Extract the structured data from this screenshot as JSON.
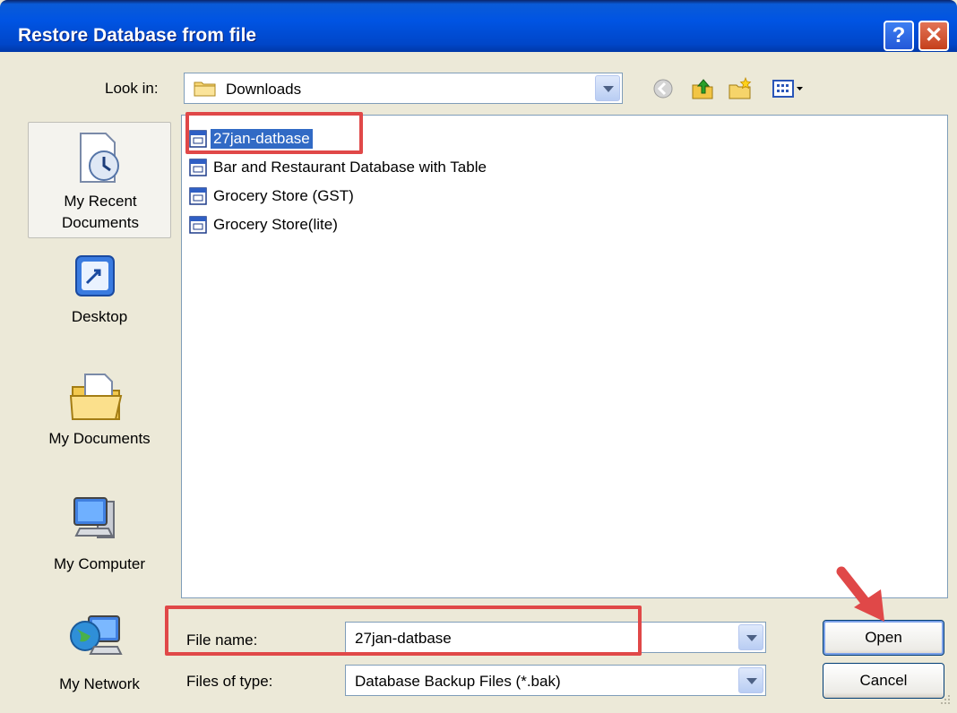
{
  "window": {
    "title": "Restore Database from file",
    "help_glyph": "?",
    "close_glyph": "✕"
  },
  "lookin": {
    "label": "Look in:",
    "value": "Downloads"
  },
  "toolbar": [
    "back-icon",
    "up-folder-icon",
    "new-folder-icon",
    "views-menu-icon"
  ],
  "places": [
    {
      "label_line1": "My Recent",
      "label_line2": "Documents",
      "icon": "recent-documents-icon"
    },
    {
      "label": "Desktop",
      "icon": "desktop-icon"
    },
    {
      "label": "My Documents",
      "icon": "my-documents-icon"
    },
    {
      "label": "My Computer",
      "icon": "my-computer-icon"
    },
    {
      "label": "My Network",
      "icon": "my-network-icon"
    }
  ],
  "files": [
    {
      "name": "27jan-datbase",
      "selected": true
    },
    {
      "name": "Bar and Restaurant Database with Table",
      "selected": false
    },
    {
      "name": "Grocery Store (GST)",
      "selected": false
    },
    {
      "name": "Grocery Store(lite)",
      "selected": false
    }
  ],
  "filename": {
    "label": "File name:",
    "value": "27jan-datbase"
  },
  "filetype": {
    "label": "Files of type:",
    "value": "Database Backup Files (*.bak)"
  },
  "buttons": {
    "open": "Open",
    "cancel": "Cancel"
  },
  "colors": {
    "titlebar": "#0054e3",
    "selection": "#316ac5",
    "highlight_box": "#e04848"
  }
}
